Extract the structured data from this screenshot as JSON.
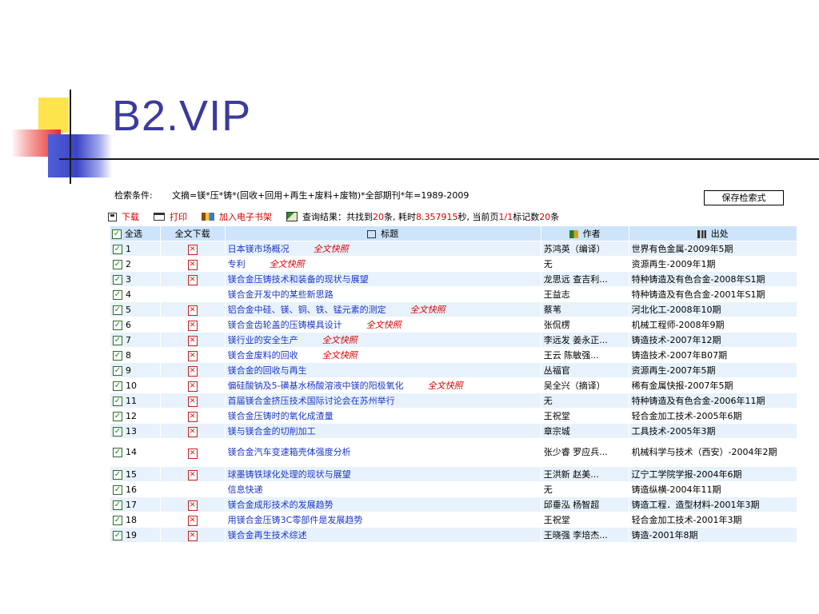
{
  "slide": {
    "title": "B2.VIP"
  },
  "search": {
    "condition_label": "检索条件:",
    "condition_text": "文摘=镁*压*铸*(回收+回用+再生+废料+废物)*全部期刊*年=1989-2009",
    "save_label": "保存检索式"
  },
  "toolbar": {
    "download": "下载",
    "print": "打印",
    "add_shelf": "加入电子书架",
    "result_prefix": "查询结果：共找到",
    "result_count": "20",
    "result_mid": "条, 耗时",
    "result_time": "8.357915",
    "result_mid2": "秒, 当前页",
    "result_page": "1/1",
    "result_mid3": "标记数",
    "result_marked": "20",
    "result_suffix": "条"
  },
  "table": {
    "headers": {
      "select_all": "全选",
      "download": "全文下载",
      "title": "标题",
      "author": "作者",
      "source": "出处"
    },
    "fulltext_label": "全文快照",
    "rows": [
      {
        "num": "1",
        "pdf": true,
        "title": "日本镁市场概况",
        "fulltext": true,
        "author": "苏鸿英（编译）",
        "source": "世界有色金属-2009年5期"
      },
      {
        "num": "2",
        "pdf": true,
        "title": "专利",
        "fulltext": true,
        "author": "无",
        "source": "资源再生-2009年1期"
      },
      {
        "num": "3",
        "pdf": true,
        "title": "镁合金压铸技术和装备的现状与展望",
        "fulltext": false,
        "author": "龙思远 查吉利...",
        "source": "特种铸造及有色合金-2008年S1期"
      },
      {
        "num": "4",
        "pdf": false,
        "title": "镁合金开发中的某些新思路",
        "fulltext": false,
        "author": "王益志",
        "source": "特种铸造及有色合金-2001年S1期"
      },
      {
        "num": "5",
        "pdf": true,
        "title": "铝合金中硅、镁、铜、铁、锰元素的测定",
        "fulltext": true,
        "author": "蔡苇",
        "source": "河北化工-2008年10期"
      },
      {
        "num": "6",
        "pdf": true,
        "title": "镁合金齿轮盖的压铸模具设计",
        "fulltext": true,
        "author": "张侃楞",
        "source": "机械工程师-2008年9期"
      },
      {
        "num": "7",
        "pdf": true,
        "title": "镁行业的安全生产",
        "fulltext": true,
        "author": "李远发 姜永正...",
        "source": "铸造技术-2007年12期"
      },
      {
        "num": "8",
        "pdf": true,
        "title": "镁合金废料的回收",
        "fulltext": true,
        "author": "王云 陈敏强...",
        "source": "铸造技术-2007年B07期"
      },
      {
        "num": "9",
        "pdf": true,
        "title": "镁合金的回收与再生",
        "fulltext": false,
        "author": "丛福官",
        "source": "资源再生-2007年5期"
      },
      {
        "num": "10",
        "pdf": true,
        "title": "偏硅酸钠及5-磺基水杨酸溶液中镁的阳极氧化",
        "fulltext": true,
        "author": "吴全兴（摘译）",
        "source": "稀有金属快报-2007年5期"
      },
      {
        "num": "11",
        "pdf": true,
        "title": "首届镁合金挤压技术国际讨论会在苏州举行",
        "fulltext": false,
        "author": "无",
        "source": "特种铸造及有色合金-2006年11期"
      },
      {
        "num": "12",
        "pdf": true,
        "title": "镁合金压铸时的氧化成渣量",
        "fulltext": false,
        "author": "王祝堂",
        "source": "轻合金加工技术-2005年6期"
      },
      {
        "num": "13",
        "pdf": true,
        "title": "镁与镁合金的切削加工",
        "fulltext": false,
        "author": "章宗城",
        "source": "工具技术-2005年3期"
      },
      {
        "num": "14",
        "pdf": true,
        "title": "镁合金汽车变速箱壳体强度分析",
        "fulltext": false,
        "author": "张少睿 罗应兵...",
        "source": "机械科学与技术（西安）-2004年2期",
        "tall": true
      },
      {
        "num": "15",
        "pdf": true,
        "title": "球墨铸铁球化处理的现状与展望",
        "fulltext": false,
        "author": "王洪新 赵美...",
        "source": "辽宁工学院学报-2004年6期"
      },
      {
        "num": "16",
        "pdf": false,
        "title": "信息快递",
        "fulltext": false,
        "author": "无",
        "source": "铸造纵横-2004年11期"
      },
      {
        "num": "17",
        "pdf": true,
        "title": "镁合金成形技术的发展趋势",
        "fulltext": false,
        "author": "邱垂泓 杨智超",
        "source": "铸造工程．造型材料-2001年3期"
      },
      {
        "num": "18",
        "pdf": true,
        "title": "用镁合金压铸3C零部件是发展趋势",
        "fulltext": false,
        "author": "王祝堂",
        "source": "轻合金加工技术-2001年3期"
      },
      {
        "num": "19",
        "pdf": true,
        "title": "镁合金再生技术综述",
        "fulltext": false,
        "author": "王晓强 李培杰...",
        "source": "铸造-2001年8期"
      }
    ]
  }
}
